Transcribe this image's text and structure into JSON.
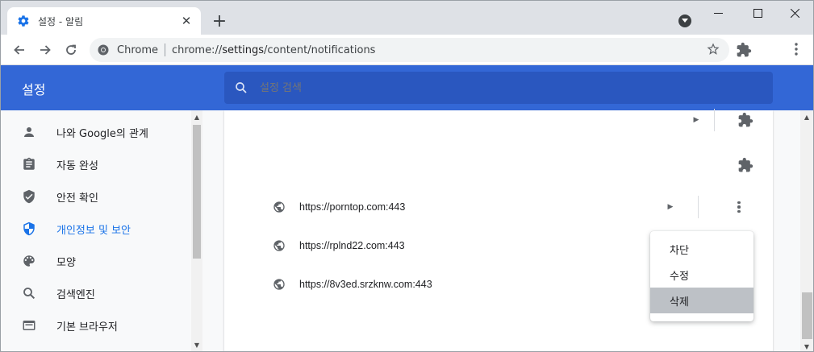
{
  "tab": {
    "title": "설정 - 알림",
    "close_glyph": "✕",
    "new_tab_glyph": "+"
  },
  "window_controls": {
    "minimize": "—",
    "maximize": "☐",
    "close": "✕"
  },
  "toolbar": {
    "site_label": "Chrome",
    "url_scheme": "chrome://",
    "url_host": "settings",
    "url_path": "/content/notifications"
  },
  "header": {
    "title": "설정",
    "search_placeholder": "설정 검색"
  },
  "sidebar": {
    "items": [
      {
        "label": "나와 Google의 관계",
        "icon": "person-icon"
      },
      {
        "label": "자동 완성",
        "icon": "clipboard-icon"
      },
      {
        "label": "안전 확인",
        "icon": "shield-check-icon"
      },
      {
        "label": "개인정보 및 보안",
        "icon": "shield-icon",
        "active": true
      },
      {
        "label": "모양",
        "icon": "palette-icon"
      },
      {
        "label": "검색엔진",
        "icon": "search-icon"
      },
      {
        "label": "기본 브라우저",
        "icon": "browser-icon"
      }
    ]
  },
  "sites": [
    {
      "url": "https://porntop.com:443"
    },
    {
      "url": "https://rplnd22.com:443"
    },
    {
      "url": "https://8v3ed.srzknw.com:443"
    }
  ],
  "context_menu": {
    "items": [
      {
        "label": "차단"
      },
      {
        "label": "수정"
      },
      {
        "label": "삭제",
        "highlighted": true
      }
    ]
  },
  "colors": {
    "header_bg": "#3367d6",
    "accent": "#1a73e8",
    "menu_highlight": "#bdc1c6"
  }
}
